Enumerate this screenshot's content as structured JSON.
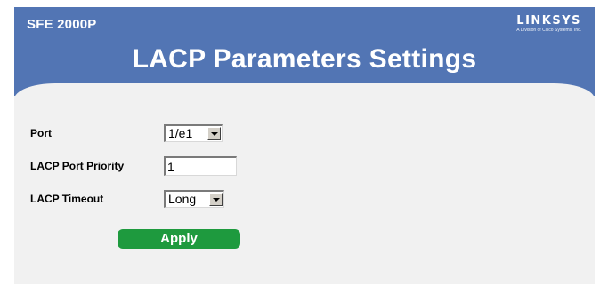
{
  "header": {
    "model": "SFE 2000P",
    "brand": "LINKSYS",
    "brand_tagline": "A Division of Cisco Systems, Inc.",
    "title": "LACP Parameters Settings",
    "color": "#5275b4"
  },
  "form": {
    "port": {
      "label": "Port",
      "value": "1/e1"
    },
    "priority": {
      "label": "LACP Port Priority",
      "value": "1"
    },
    "timeout": {
      "label": "LACP Timeout",
      "value": "Long"
    }
  },
  "apply_label": "Apply",
  "colors": {
    "apply_button": "#1e9a3e",
    "background": "#f1f1f1"
  }
}
